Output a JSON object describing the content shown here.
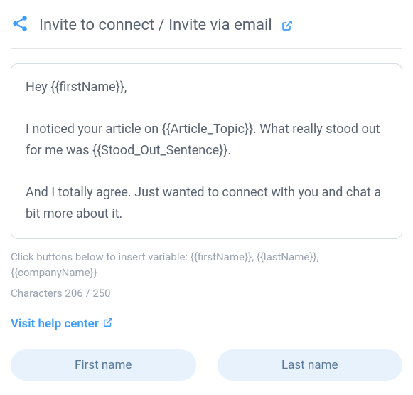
{
  "header": {
    "title": "Invite to connect / Invite via email"
  },
  "message": {
    "line1": "Hey  {{firstName}},",
    "line2": "I noticed your article on {{Article_Topic}}. What really stood out for me was {{Stood_Out_Sentence}}.",
    "line3": "And I totally agree. Just wanted to connect with you and chat a bit more about it."
  },
  "hint": "Click buttons below to insert variable: {{firstName}}, {{lastName}}, {{companyName}}",
  "charCount": {
    "current": 206,
    "max": 250,
    "display": "Characters 206 / 250"
  },
  "helpLink": {
    "label": "Visit help center"
  },
  "buttons": {
    "firstName": "First name",
    "lastName": "Last name"
  }
}
